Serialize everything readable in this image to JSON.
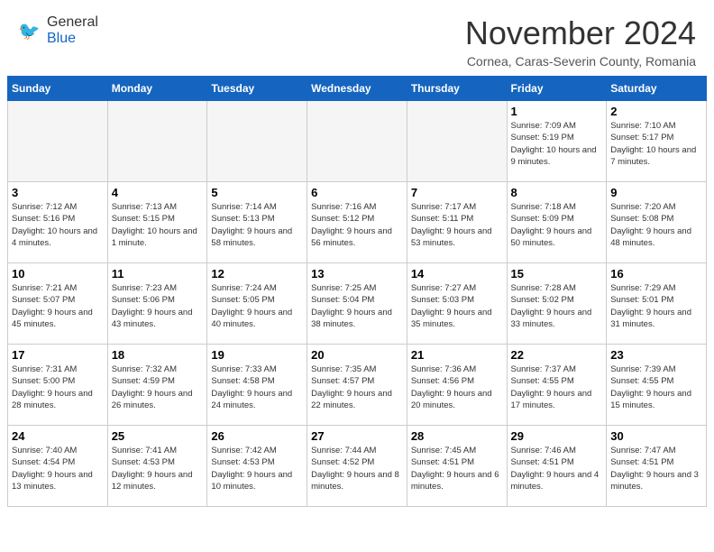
{
  "header": {
    "logo": {
      "general": "General",
      "blue": "Blue"
    },
    "title": "November 2024",
    "location": "Cornea, Caras-Severin County, Romania"
  },
  "calendar": {
    "days_of_week": [
      "Sunday",
      "Monday",
      "Tuesday",
      "Wednesday",
      "Thursday",
      "Friday",
      "Saturday"
    ],
    "weeks": [
      {
        "days": [
          {
            "empty": true
          },
          {
            "empty": true
          },
          {
            "empty": true
          },
          {
            "empty": true
          },
          {
            "empty": true
          },
          {
            "num": "1",
            "sunrise": "7:09 AM",
            "sunset": "5:19 PM",
            "daylight": "10 hours and 9 minutes."
          },
          {
            "num": "2",
            "sunrise": "7:10 AM",
            "sunset": "5:17 PM",
            "daylight": "10 hours and 7 minutes."
          }
        ]
      },
      {
        "days": [
          {
            "num": "3",
            "sunrise": "7:12 AM",
            "sunset": "5:16 PM",
            "daylight": "10 hours and 4 minutes."
          },
          {
            "num": "4",
            "sunrise": "7:13 AM",
            "sunset": "5:15 PM",
            "daylight": "10 hours and 1 minute."
          },
          {
            "num": "5",
            "sunrise": "7:14 AM",
            "sunset": "5:13 PM",
            "daylight": "9 hours and 58 minutes."
          },
          {
            "num": "6",
            "sunrise": "7:16 AM",
            "sunset": "5:12 PM",
            "daylight": "9 hours and 56 minutes."
          },
          {
            "num": "7",
            "sunrise": "7:17 AM",
            "sunset": "5:11 PM",
            "daylight": "9 hours and 53 minutes."
          },
          {
            "num": "8",
            "sunrise": "7:18 AM",
            "sunset": "5:09 PM",
            "daylight": "9 hours and 50 minutes."
          },
          {
            "num": "9",
            "sunrise": "7:20 AM",
            "sunset": "5:08 PM",
            "daylight": "9 hours and 48 minutes."
          }
        ]
      },
      {
        "days": [
          {
            "num": "10",
            "sunrise": "7:21 AM",
            "sunset": "5:07 PM",
            "daylight": "9 hours and 45 minutes."
          },
          {
            "num": "11",
            "sunrise": "7:23 AM",
            "sunset": "5:06 PM",
            "daylight": "9 hours and 43 minutes."
          },
          {
            "num": "12",
            "sunrise": "7:24 AM",
            "sunset": "5:05 PM",
            "daylight": "9 hours and 40 minutes."
          },
          {
            "num": "13",
            "sunrise": "7:25 AM",
            "sunset": "5:04 PM",
            "daylight": "9 hours and 38 minutes."
          },
          {
            "num": "14",
            "sunrise": "7:27 AM",
            "sunset": "5:03 PM",
            "daylight": "9 hours and 35 minutes."
          },
          {
            "num": "15",
            "sunrise": "7:28 AM",
            "sunset": "5:02 PM",
            "daylight": "9 hours and 33 minutes."
          },
          {
            "num": "16",
            "sunrise": "7:29 AM",
            "sunset": "5:01 PM",
            "daylight": "9 hours and 31 minutes."
          }
        ]
      },
      {
        "days": [
          {
            "num": "17",
            "sunrise": "7:31 AM",
            "sunset": "5:00 PM",
            "daylight": "9 hours and 28 minutes."
          },
          {
            "num": "18",
            "sunrise": "7:32 AM",
            "sunset": "4:59 PM",
            "daylight": "9 hours and 26 minutes."
          },
          {
            "num": "19",
            "sunrise": "7:33 AM",
            "sunset": "4:58 PM",
            "daylight": "9 hours and 24 minutes."
          },
          {
            "num": "20",
            "sunrise": "7:35 AM",
            "sunset": "4:57 PM",
            "daylight": "9 hours and 22 minutes."
          },
          {
            "num": "21",
            "sunrise": "7:36 AM",
            "sunset": "4:56 PM",
            "daylight": "9 hours and 20 minutes."
          },
          {
            "num": "22",
            "sunrise": "7:37 AM",
            "sunset": "4:55 PM",
            "daylight": "9 hours and 17 minutes."
          },
          {
            "num": "23",
            "sunrise": "7:39 AM",
            "sunset": "4:55 PM",
            "daylight": "9 hours and 15 minutes."
          }
        ]
      },
      {
        "days": [
          {
            "num": "24",
            "sunrise": "7:40 AM",
            "sunset": "4:54 PM",
            "daylight": "9 hours and 13 minutes."
          },
          {
            "num": "25",
            "sunrise": "7:41 AM",
            "sunset": "4:53 PM",
            "daylight": "9 hours and 12 minutes."
          },
          {
            "num": "26",
            "sunrise": "7:42 AM",
            "sunset": "4:53 PM",
            "daylight": "9 hours and 10 minutes."
          },
          {
            "num": "27",
            "sunrise": "7:44 AM",
            "sunset": "4:52 PM",
            "daylight": "9 hours and 8 minutes."
          },
          {
            "num": "28",
            "sunrise": "7:45 AM",
            "sunset": "4:51 PM",
            "daylight": "9 hours and 6 minutes."
          },
          {
            "num": "29",
            "sunrise": "7:46 AM",
            "sunset": "4:51 PM",
            "daylight": "9 hours and 4 minutes."
          },
          {
            "num": "30",
            "sunrise": "7:47 AM",
            "sunset": "4:51 PM",
            "daylight": "9 hours and 3 minutes."
          }
        ]
      }
    ]
  }
}
